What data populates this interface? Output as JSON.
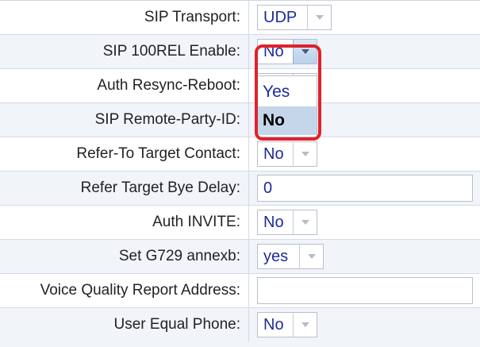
{
  "settings": [
    {
      "label": "SIP Transport:",
      "control": "select",
      "value": "UDP"
    },
    {
      "label": "SIP 100REL Enable:",
      "control": "select",
      "value": "No",
      "open": true
    },
    {
      "label": "Auth Resync-Reboot:",
      "control": "select",
      "value": ""
    },
    {
      "label": "SIP Remote-Party-ID:",
      "control": "select",
      "value": ""
    },
    {
      "label": "Refer-To Target Contact:",
      "control": "select",
      "value": "No"
    },
    {
      "label": "Refer Target Bye Delay:",
      "control": "text",
      "value": "0"
    },
    {
      "label": "Auth INVITE:",
      "control": "select",
      "value": "No"
    },
    {
      "label": "Set G729 annexb:",
      "control": "select",
      "value": "yes"
    },
    {
      "label": "Voice Quality Report Address:",
      "control": "text",
      "value": ""
    },
    {
      "label": "User Equal Phone:",
      "control": "select",
      "value": "No"
    }
  ],
  "dropdown": {
    "options": [
      "Yes",
      "No"
    ],
    "selected": "No"
  },
  "colors": {
    "value_text": "#1d2b9c",
    "highlight_border": "#e0222b",
    "selected_option_bg": "#c6d6ea",
    "alt_row_bg": "#f1f4f9"
  },
  "icons": {
    "select_arrow": "chevron-down-icon"
  }
}
